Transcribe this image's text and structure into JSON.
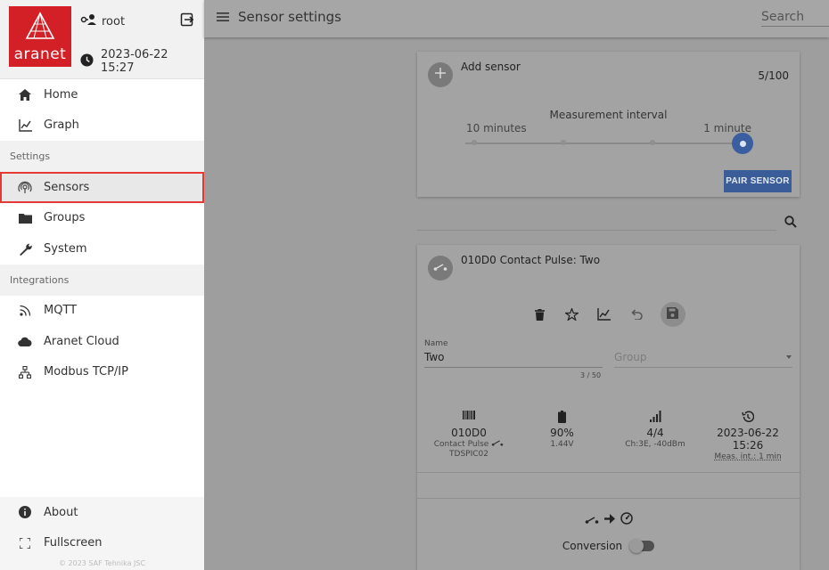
{
  "sidebar": {
    "logo_text": "aranet",
    "user": "root",
    "datetime": "2023-06-22 15:27",
    "items": [
      {
        "label": "Home"
      },
      {
        "label": "Graph"
      }
    ],
    "settings_heading": "Settings",
    "settings_items": [
      {
        "label": "Sensors"
      },
      {
        "label": "Groups"
      },
      {
        "label": "System"
      }
    ],
    "integrations_heading": "Integrations",
    "integration_items": [
      {
        "label": "MQTT"
      },
      {
        "label": "Aranet Cloud"
      },
      {
        "label": "Modbus TCP/IP"
      }
    ],
    "bottom_items": [
      {
        "label": "About"
      },
      {
        "label": "Fullscreen"
      }
    ],
    "copyright": "© 2023 SAF Tehnika JSC"
  },
  "topbar": {
    "title": "Sensor settings",
    "search_placeholder": "Search"
  },
  "add_sensor": {
    "title": "Add sensor",
    "count": "5/100",
    "interval_label": "Measurement interval",
    "slider_min_label": "10 minutes",
    "slider_max_label": "1 minute",
    "pair_button": "PAIR SENSOR"
  },
  "sensor": {
    "title": "010D0 Contact Pulse: Two",
    "name_label": "Name",
    "name_value": "Two",
    "name_counter": "3 / 50",
    "group_placeholder": "Group",
    "id": "010D0",
    "type": "Contact Pulse",
    "model": "TDSPIC02",
    "battery": "90%",
    "voltage": "1.44V",
    "signal": "4/4",
    "channel": "Ch:3E, -40dBm",
    "last_seen": "2023-06-22 15:26",
    "meas_interval": "Meas. int.: 1 min",
    "conversion_label": "Conversion"
  },
  "colors": {
    "brand": "#d32027",
    "accent": "#3a5d99",
    "highlight_outline": "#e53935"
  }
}
